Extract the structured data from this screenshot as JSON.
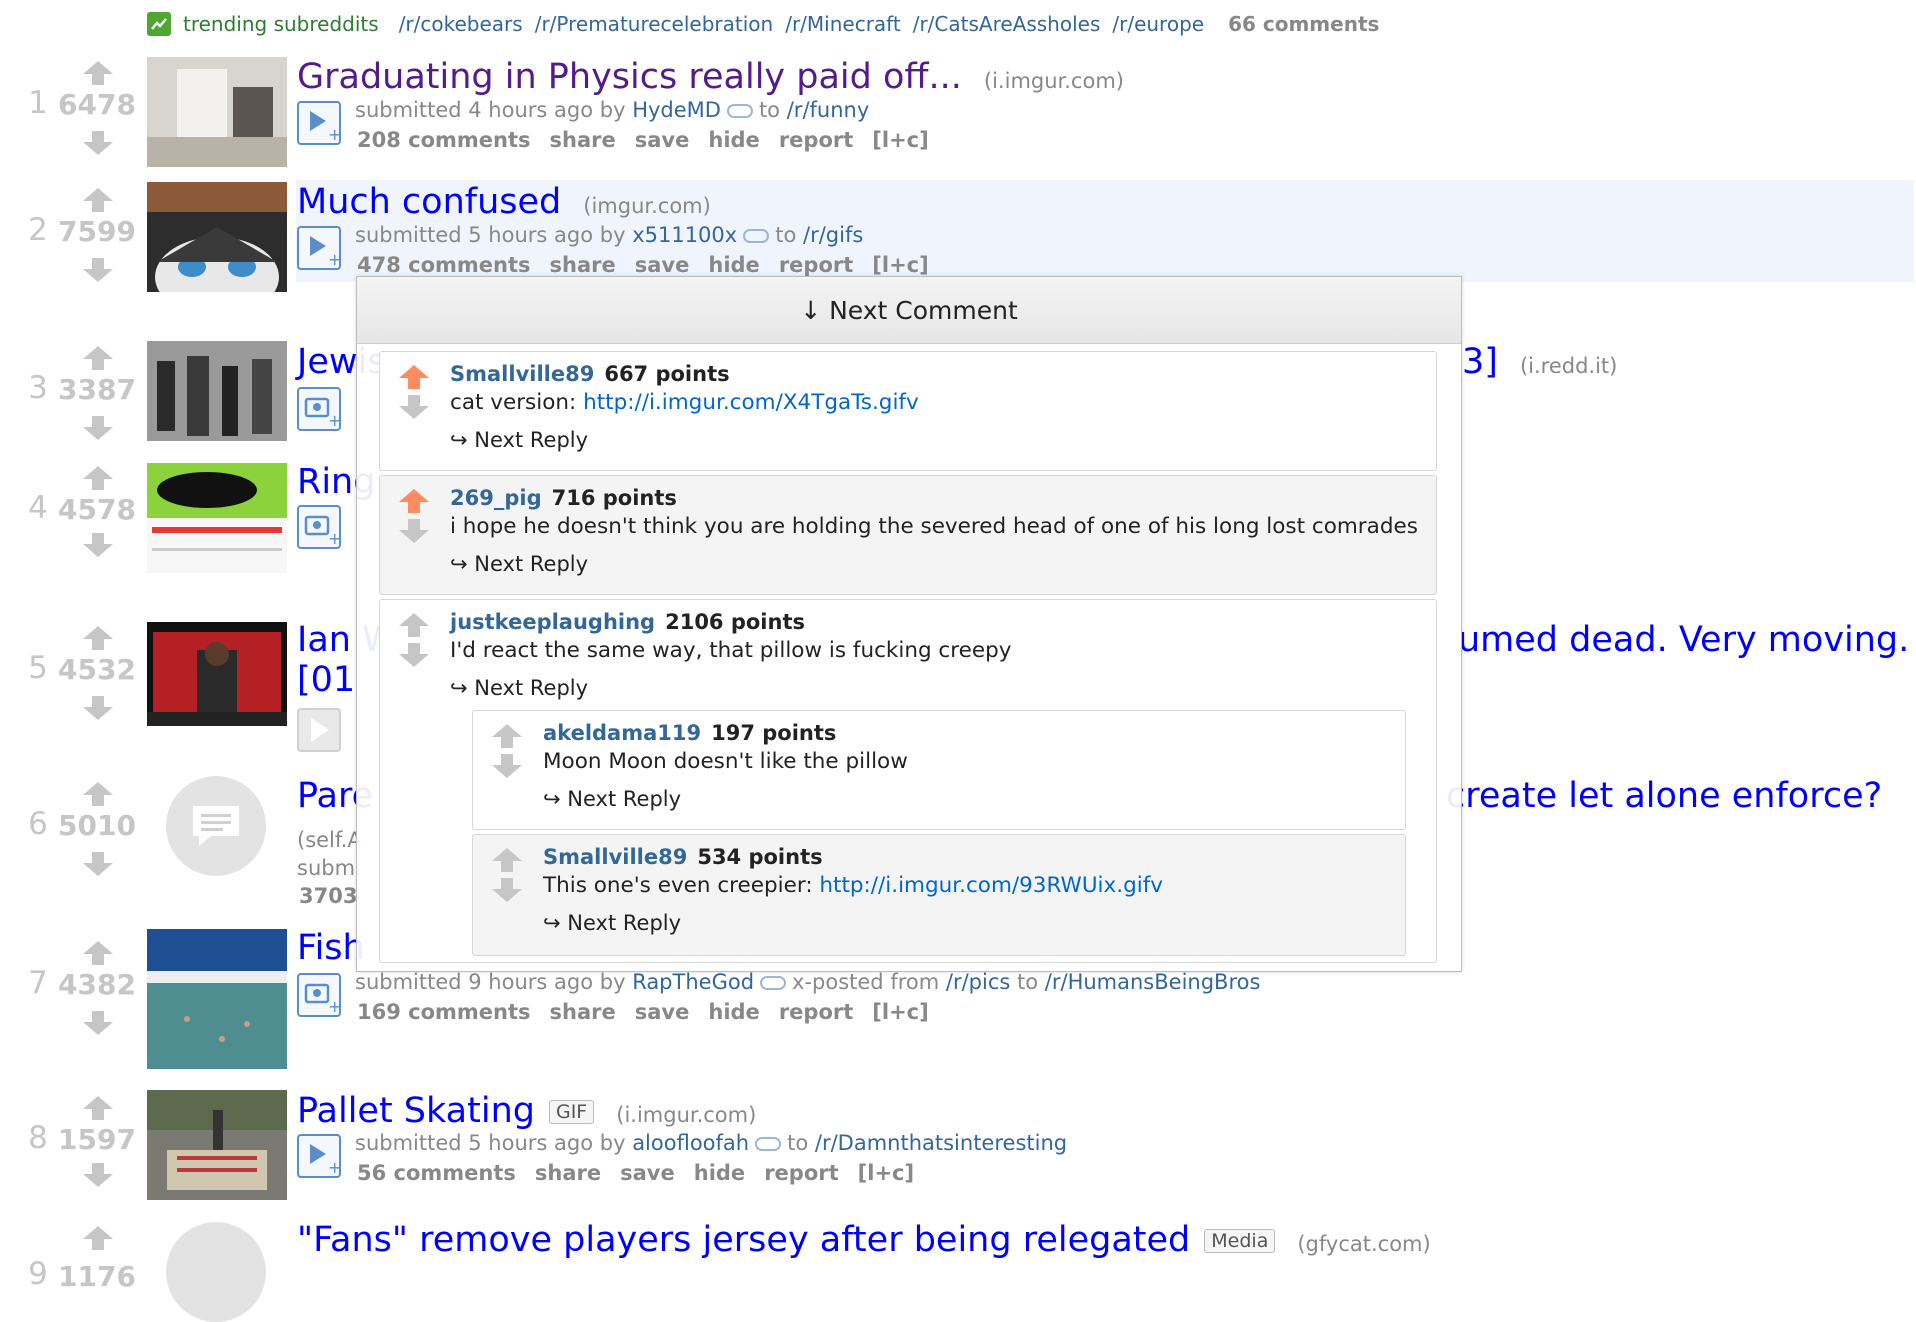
{
  "trending": {
    "label": "trending subreddits",
    "subs": [
      "/r/cokebears",
      "/r/Prematurecelebration",
      "/r/Minecraft",
      "/r/CatsAreAssholes",
      "/r/europe"
    ],
    "comments": "66 comments"
  },
  "posts": [
    {
      "rank": "1",
      "score": "6478",
      "title": "Graduating in Physics really paid off...",
      "domain": "(i.imgur.com)",
      "submitted": "submitted 4 hours ago by",
      "author": "HydeMD",
      "to": "to",
      "subreddit": "/r/funny",
      "comments": "208 comments"
    },
    {
      "rank": "2",
      "score": "7599",
      "title": "Much confused",
      "domain": "(imgur.com)",
      "submitted": "submitted 5 hours ago by",
      "author": "x511100x",
      "to": "to",
      "subreddit": "/r/gifs",
      "comments": "478 comments"
    },
    {
      "rank": "3",
      "score": "3387",
      "title": "Jewis",
      "title_tail": "3]",
      "domain": "(i.redd.it)"
    },
    {
      "rank": "4",
      "score": "4578",
      "title": "Ring"
    },
    {
      "rank": "5",
      "score": "4532",
      "title": "Ian W",
      "title_tail": "umed dead. Very moving. -",
      "title_line2": "[01"
    },
    {
      "rank": "6",
      "score": "5010",
      "title": "Pare",
      "title_tail": "create let alone enforce?",
      "domain_partial": "(self.A",
      "submitted_partial": "submi",
      "comments_partial": "3703"
    },
    {
      "rank": "7",
      "score": "4382",
      "title": "Fish",
      "submitted": "submitted 9 hours ago by",
      "author": "RapTheGod",
      "xposted": "x-posted from",
      "xposted_sub": "/r/pics",
      "to": "to",
      "subreddit": "/r/HumansBeingBros",
      "comments": "169 comments"
    },
    {
      "rank": "8",
      "score": "1597",
      "title": "Pallet Skating",
      "flair": "GIF",
      "domain": "(i.imgur.com)",
      "submitted": "submitted 5 hours ago by",
      "author": "aloofloofah",
      "to": "to",
      "subreddit": "/r/Damnthatsinteresting",
      "comments": "56 comments"
    },
    {
      "rank": "9",
      "score": "1176",
      "title": "\"Fans\" remove players jersey after being relegated",
      "flair": "Media",
      "domain": "(gfycat.com)"
    }
  ],
  "buttons": {
    "share": "share",
    "save": "save",
    "hide": "hide",
    "report": "report",
    "lc": "[l+c]"
  },
  "overlay": {
    "header": "↓ Next Comment",
    "reply_label": "Next Reply",
    "comments": [
      {
        "user": "Smallville89",
        "points": "667 points",
        "text": "cat version:",
        "link": "http://i.imgur.com/X4TgaTs.gifv"
      },
      {
        "user": "269_pig",
        "points": "716 points",
        "text": "i hope he doesn't think you are holding the severed head of one of his long lost comrades"
      },
      {
        "user": "justkeeplaughing",
        "points": "2106 points",
        "text": "I'd react the same way, that pillow is fucking creepy"
      },
      {
        "user": "akeldama119",
        "points": "197 points",
        "text": "Moon Moon doesn't like the pillow"
      },
      {
        "user": "Smallville89",
        "points": "534 points",
        "text": "This one's even creepier:",
        "link": "http://i.imgur.com/93RWUix.gifv"
      }
    ]
  },
  "colors": {
    "link": "#0000ff",
    "visited": "#551a8b",
    "meta_blue": "#336699",
    "upvote": "#ff8b60",
    "muted": "#c6c6c6"
  }
}
